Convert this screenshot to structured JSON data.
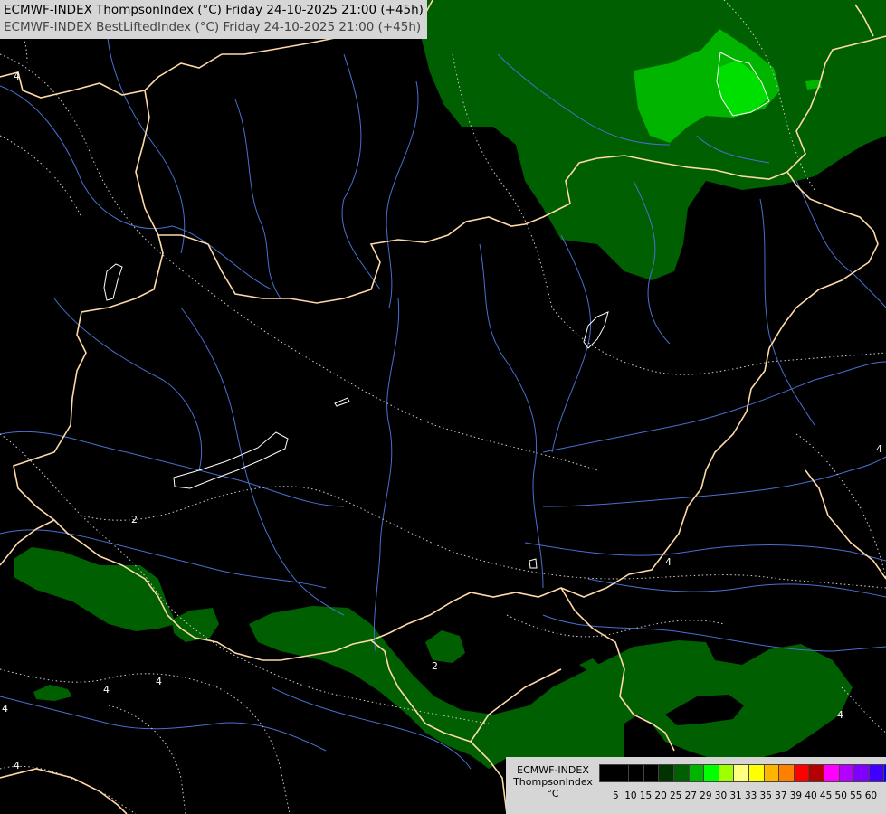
{
  "header": {
    "line1": "ECMWF-INDEX ThompsonIndex (°C) Friday 24-10-2025 21:00 (+45h)",
    "line2": "ECMWF-INDEX BestLiftedIndex (°C) Friday 24-10-2025 21:00 (+45h)"
  },
  "legend": {
    "model": "ECMWF-INDEX",
    "parameter": "ThompsonIndex",
    "unit": "°C",
    "swatches": [
      {
        "color": "#000000"
      },
      {
        "color": "#000000"
      },
      {
        "color": "#000000"
      },
      {
        "color": "#000000"
      },
      {
        "color": "#003300"
      },
      {
        "color": "#005f00"
      },
      {
        "color": "#00b400"
      },
      {
        "color": "#00ff00"
      },
      {
        "color": "#a0ff00"
      },
      {
        "color": "#ffff80"
      },
      {
        "color": "#ffff00"
      },
      {
        "color": "#ffb400"
      },
      {
        "color": "#ff8000"
      },
      {
        "color": "#ff0000"
      },
      {
        "color": "#b40000"
      },
      {
        "color": "#ff00ff"
      },
      {
        "color": "#b400ff"
      },
      {
        "color": "#8000ff"
      },
      {
        "color": "#4000ff"
      },
      {
        "color": "#0000ff"
      }
    ],
    "ticks": [
      "5",
      "10",
      "15",
      "20",
      "25",
      "27",
      "29",
      "30",
      "31",
      "33",
      "35",
      "37",
      "39",
      "40",
      "45",
      "50",
      "55",
      "60"
    ]
  },
  "contour_labels": [
    "4",
    "2",
    "2",
    "4",
    "4",
    "4",
    "4",
    "4",
    "4",
    "4"
  ],
  "map_colors": {
    "background": "#000000",
    "dark_green": "#005f00",
    "mid_green": "#00b400",
    "bright_green": "#00ff00",
    "border": "#ffd9a8",
    "river": "#4a6fd0"
  }
}
